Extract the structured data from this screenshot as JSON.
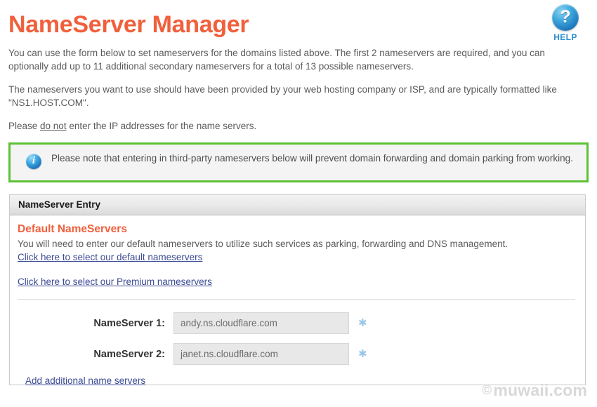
{
  "header": {
    "title": "NameServer Manager",
    "help": {
      "icon": "question-mark-circle-icon",
      "glyph": "?",
      "label": "HELP"
    },
    "title_color": "#f0603c",
    "help_color": "#2a8fd0"
  },
  "intro": {
    "paragraph1": "You can use the form below to set nameservers for the domains listed above. The first 2 nameservers are required, and you can optionally add up to 11 additional secondary nameservers for a total of 13 possible nameservers.",
    "paragraph2": "The nameservers you want to use should have been provided by your web hosting company or ISP, and are typically formatted like \"NS1.HOST.COM\".",
    "paragraph3_before": "Please ",
    "paragraph3_underlined": "do not",
    "paragraph3_after": " enter the IP addresses for the name servers."
  },
  "note": {
    "icon": "info-circle-icon",
    "glyph": "i",
    "text": "Please note that entering in third-party nameservers below will prevent domain forwarding and domain parking from working.",
    "border_color": "#5bc236",
    "background_color": "#f4f4f4"
  },
  "panel": {
    "header_title": "NameServer Entry",
    "section_title": "Default NameServers",
    "section_desc": "You will need to enter our default nameservers to utilize such services as parking, forwarding and DNS management.",
    "link_default": "Click here to select our default nameservers",
    "link_premium": "Click here to select our Premium nameservers",
    "link_add": "Add additional name servers",
    "link_color": "#3b4a94",
    "section_title_color": "#f0603c",
    "fields": [
      {
        "label": "NameServer 1:",
        "value": "andy.ns.cloudflare.com",
        "placeholder": "",
        "required_marker": "✱"
      },
      {
        "label": "NameServer 2:",
        "value": "janet.ns.cloudflare.com",
        "placeholder": "",
        "required_marker": "✱"
      }
    ]
  },
  "watermark": {
    "symbol": "©",
    "text": "muwaii.com"
  }
}
